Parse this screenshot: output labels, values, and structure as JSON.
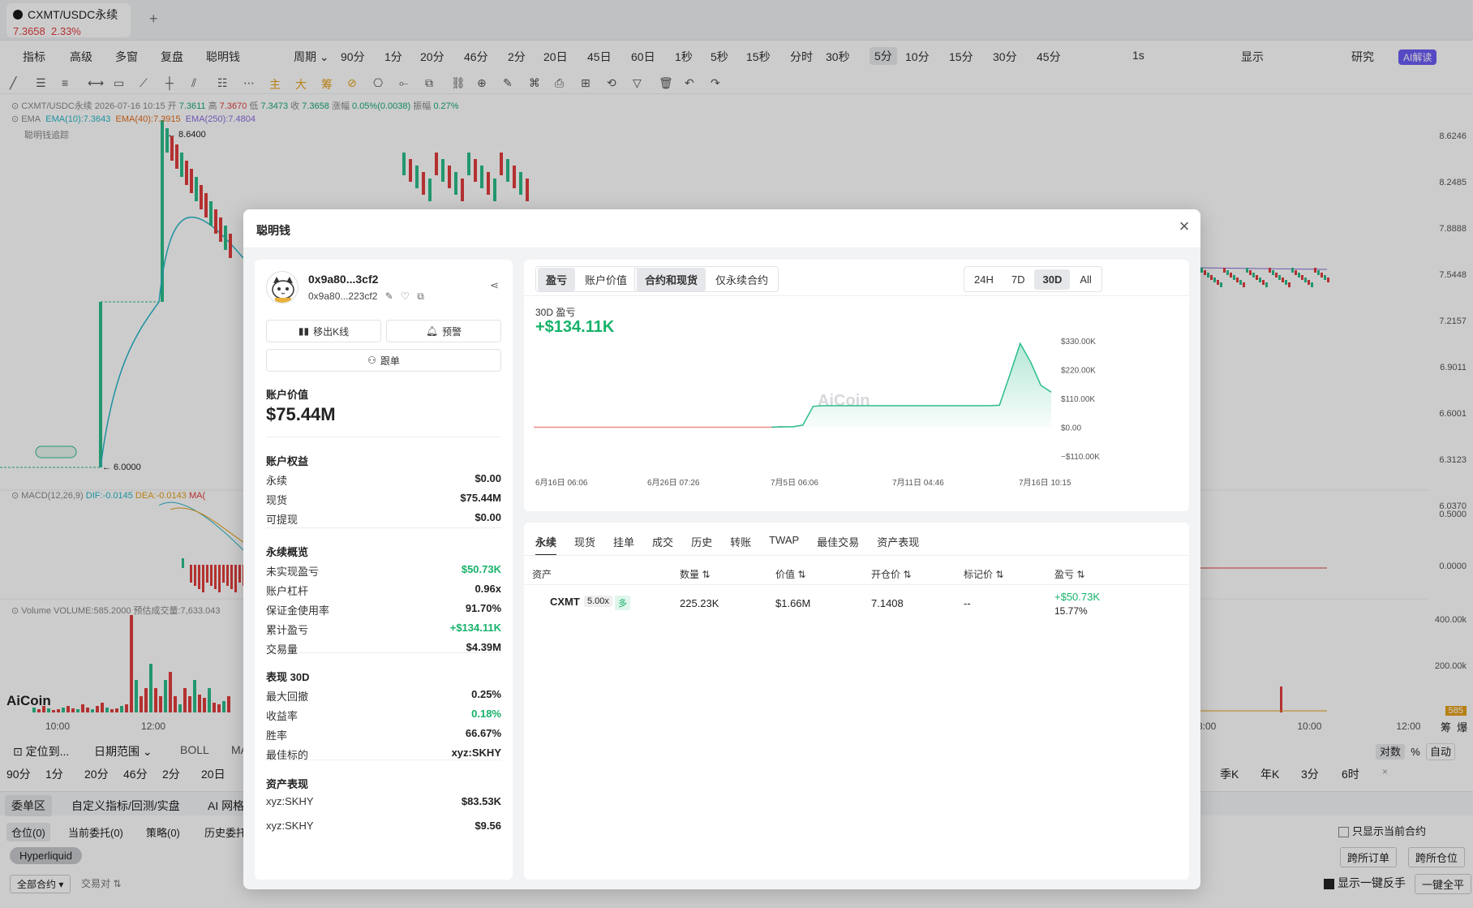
{
  "tab": {
    "symbol": "CXMT/USDC永续",
    "price": "7.3658",
    "change": "2.33%",
    "add": "+"
  },
  "toolbar1": {
    "left": [
      {
        "label": "指标",
        "x": 28
      },
      {
        "label": "高级",
        "x": 86
      },
      {
        "label": "多窗",
        "x": 142
      },
      {
        "label": "复盘",
        "x": 198
      },
      {
        "label": "聪明钱",
        "x": 254
      },
      {
        "label": "周期 ⌄",
        "x": 362
      }
    ],
    "periods": [
      "90分",
      "1分",
      "20分",
      "46分",
      "2分",
      "20日",
      "45日",
      "60日",
      "1秒",
      "5秒",
      "15秒",
      "分时",
      "30秒",
      "5分",
      "10分",
      "15分",
      "30分",
      "45分"
    ],
    "active_period": "5分",
    "right": [
      "1s",
      "显示",
      "研究",
      "AI解读"
    ]
  },
  "chart": {
    "legend_main": {
      "symbol": "CXMT/USDC永续",
      "date": "2026-07-16 10:15",
      "open_l": "开",
      "open": "7.3611",
      "high_l": "高",
      "high": "7.3670",
      "low_l": "低",
      "low": "7.3473",
      "close_l": "收",
      "close": "7.3658",
      "chg_l": "涨幅",
      "chg": "0.05%(0.0038)",
      "amp_l": "振幅",
      "amp": "0.27%"
    },
    "legend_ema": {
      "name": "EMA",
      "ema10": "EMA(10):7.3643",
      "ema40": "EMA(40):7.3915",
      "ema250": "EMA(250):7.4804"
    },
    "smart_money": "聪明钱追踪",
    "high_mark": "← 8.6400",
    "low_mark": "← 6.0000",
    "macd": {
      "name": "MACD(12,26,9)",
      "dif": "DIF:-0.0145",
      "dea": "DEA:-0.0143",
      "mac": "MA("
    },
    "volume": {
      "name": "Volume",
      "vol": "VOLUME:585.2000",
      "est": "预估成交量:7,633.043"
    },
    "y_labels": [
      "8.6246",
      "8.2485",
      "7.8888",
      "7.5448",
      "7.2157",
      "6.9011",
      "6.6001",
      "6.3123",
      "6.0370"
    ],
    "macd_y": [
      "0.5000",
      "0.0000"
    ],
    "vol_y": [
      "400.00k",
      "200.00k",
      "585"
    ],
    "x_labels_left": [
      "10:00",
      "12:00"
    ],
    "x_labels_right": [
      "8:00",
      "10:00",
      "12:00"
    ],
    "logo": "AiCoin"
  },
  "bottom": {
    "locate": "定位到...",
    "date_range": "日期范围 ⌄",
    "boll": "BOLL",
    "ma": "MA",
    "periods_left": [
      "90分",
      "1分",
      "20分",
      "46分",
      "2分",
      "20日"
    ],
    "periods_right": [
      "季K",
      "年K",
      "3分",
      "6时",
      "×"
    ],
    "axis_opts": [
      "对数",
      "%",
      "自动"
    ],
    "right_labels": [
      "筹",
      "爆"
    ],
    "tabs": [
      "委单区",
      "自定义指标/回测/实盘",
      "AI 网格"
    ],
    "subtabs": [
      "仓位(0)",
      "当前委托(0)",
      "策略(0)",
      "历史委托"
    ],
    "only_current": "只显示当前合约",
    "exchange": "Hyperliquid",
    "cross_order": "跨所订单",
    "cross_pos": "跨所仓位",
    "all_contracts": "全部合约 ▾",
    "pair": "交易对 ⇅",
    "one_click_reverse": "显示一键反手",
    "one_click_close": "一键全平"
  },
  "modal": {
    "title": "聪明钱",
    "address": "0x9a80...3cf2",
    "address_sub": "0x9a80...223cf2",
    "btn_remove": "移出K线",
    "btn_alert": "预警",
    "btn_follow": "跟单",
    "acct_value_title": "账户价值",
    "acct_value": "$75.44M",
    "equity_title": "账户权益",
    "equity": [
      {
        "k": "永续",
        "v": "$0.00"
      },
      {
        "k": "现货",
        "v": "$75.44M"
      },
      {
        "k": "可提现",
        "v": "$0.00"
      }
    ],
    "perp_title": "永续概览",
    "perp": [
      {
        "k": "未实现盈亏",
        "v": "$50.73K",
        "g": true
      },
      {
        "k": "账户杠杆",
        "v": "0.96x"
      },
      {
        "k": "保证金使用率",
        "v": "91.70%"
      },
      {
        "k": "累计盈亏",
        "v": "+$134.11K",
        "g": true
      },
      {
        "k": "交易量",
        "v": "$4.39M"
      }
    ],
    "perf_title": "表现 30D",
    "perf": [
      {
        "k": "最大回撤",
        "v": "0.25%"
      },
      {
        "k": "收益率",
        "v": "0.18%",
        "g": true
      },
      {
        "k": "胜率",
        "v": "66.67%"
      },
      {
        "k": "最佳标的",
        "v": "xyz:SKHY"
      }
    ],
    "asset_title": "资产表现",
    "assets": [
      {
        "k": "xyz:SKHY",
        "v": "$83.53K"
      },
      {
        "k": "xyz:SKHY",
        "v": "$9.56"
      }
    ],
    "seg1": [
      "盈亏",
      "账户价值"
    ],
    "seg2": [
      "合约和现货",
      "仅永续合约"
    ],
    "seg3": [
      "24H",
      "7D",
      "30D",
      "All"
    ],
    "pnl_label": "30D 盈亏",
    "pnl_value": "+$134.11K",
    "watermark": "AiCoin",
    "tabs": [
      "永续",
      "现货",
      "挂单",
      "成交",
      "历史",
      "转账",
      "TWAP",
      "最佳交易",
      "资产表现"
    ],
    "table_headers": [
      "资产",
      "数量 ⇅",
      "价值 ⇅",
      "开仓价 ⇅",
      "标记价 ⇅",
      "盈亏 ⇅"
    ],
    "row": {
      "asset": "CXMT",
      "lev": "5.00x",
      "side": "多",
      "qty": "225.23K",
      "value": "$1.66M",
      "entry": "7.1408",
      "mark": "--",
      "pnl": "+$50.73K",
      "pnl_pct": "15.77%"
    }
  },
  "chart_data": {
    "type": "area",
    "title": "30D 盈亏",
    "x_ticks": [
      "6月16日 06:06",
      "6月26日 07:26",
      "7月5日 06:06",
      "7月11日 04:46",
      "7月16日 10:15"
    ],
    "y_ticks": [
      "$330.00K",
      "$220.00K",
      "$110.00K",
      "$0.00",
      "−$110.00K"
    ],
    "ylim": [
      -110000,
      330000
    ],
    "series": [
      {
        "values": [
          0,
          0,
          0,
          0,
          0,
          0,
          0,
          0,
          0,
          0,
          0,
          0,
          0,
          0,
          0,
          0,
          0,
          0,
          0,
          0,
          0,
          0,
          0,
          0,
          2000,
          1500,
          8000,
          80000,
          82000,
          82000,
          82000,
          82000,
          82000,
          82000,
          82000,
          82000,
          82000,
          82000,
          82000,
          82000,
          82000,
          82000,
          82000,
          82000,
          82000,
          84000,
          200000,
          320000,
          250000,
          160000,
          134110
        ]
      }
    ],
    "colors": {
      "line_neg": "#e88a8a",
      "line_pos": "#2bbd8a",
      "fill": "#2bbd8a"
    }
  }
}
